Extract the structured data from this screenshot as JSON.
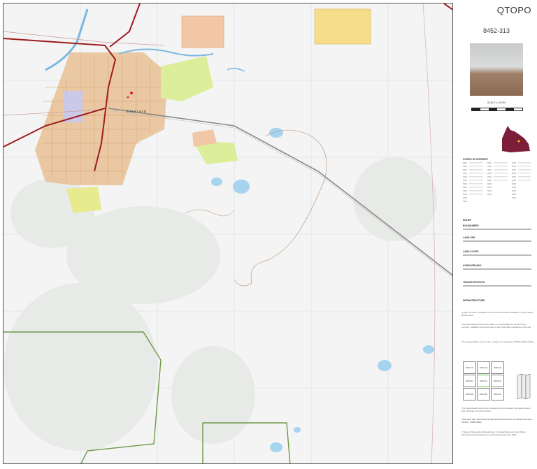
{
  "app": {
    "title": "QTOPO",
    "sheet_number": "8452-313"
  },
  "colors": {
    "urban": "#e6bf94",
    "parkland": "#dcee9a",
    "industrial": "#f2c7a6",
    "highway": "#9e1b20",
    "water": "#a6d4ee",
    "boundary_green": "#6f9a48",
    "background": "#f3f4f3",
    "queensland_inset": "#7c1d3a"
  },
  "map": {
    "town_label": "Emerald",
    "scale": "SCALE 1:10 000",
    "scale_ticks": [
      "0",
      "100",
      "200",
      "300",
      "400",
      "500"
    ]
  },
  "legend": {
    "heading": "POINTS OF INTEREST",
    "sections": [
      "RELIEF",
      "BOUNDARIES",
      "LAND USE",
      "LAND COVER",
      "HYDROGRAPHY",
      "TRANSPORTATION",
      "INFRASTRUCTURE"
    ]
  },
  "icons": [
    "queensland-locator-icon",
    "sheet-grid-icon",
    "fold-guide-icon"
  ],
  "notes": {
    "p1": "QTopo has been compiled from the best information available to Queensland Government.",
    "p2": "The Queensland Government takes no responsibility for the accuracy, currency, reliability and correctness of any information included on the map.",
    "p3": "The representation of any road or track is not evidence of Public Right of Way.",
    "p4": "The Queensland Government supports and encourages the dissemination and exchange of its information.",
    "p5": "THIS MAP MAY BE PRINTED OR REPRODUCED BY ANYONE FOR NON-PROFIT PURPOSES",
    "copyright": "© State of Queensland (Department of Natural Resources and Mines, Manufacturing and Regional and Rural Development) 2025"
  },
  "index": {
    "cells": [
      "8452-341",
      "8452-342",
      "8452-343",
      "8452-311",
      "8452-312",
      "8452-313",
      "8452-284",
      "8452-285",
      "8452-281"
    ]
  }
}
